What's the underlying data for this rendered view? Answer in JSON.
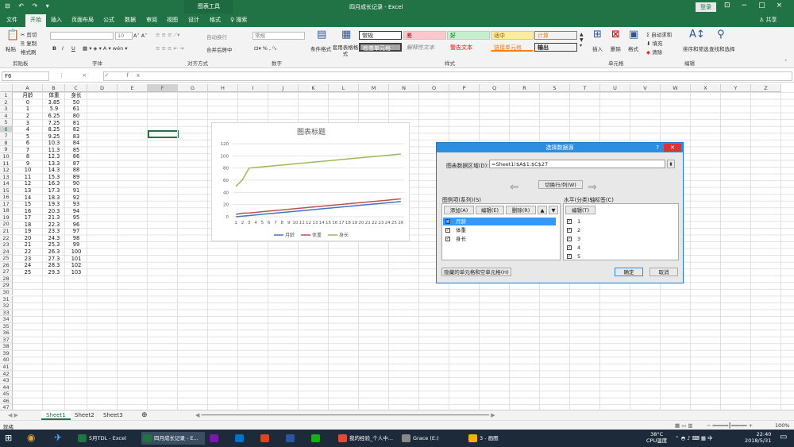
{
  "titlebar": {
    "context_tab": "图表工具",
    "window_title": "四月成长记录 - Excel",
    "login": "登录",
    "quick_access": "⊟ ↶ ↷ ▾"
  },
  "tabs": [
    "文件",
    "开始",
    "插入",
    "页面布局",
    "公式",
    "数据",
    "审阅",
    "视图",
    "设计",
    "格式",
    "♀ 搜索"
  ],
  "share": "共享",
  "ribbon": {
    "clipboard": {
      "paste": "粘贴",
      "cut": "✂ 剪切",
      "copy": "⎘ 复制",
      "format_painter": "格式刷",
      "group": "剪贴板"
    },
    "font": {
      "size": "10",
      "bold": "B",
      "italic": "I",
      "underline": "U",
      "group": "字体"
    },
    "alignment": {
      "wrap": "自动换行",
      "merge": "合并后居中",
      "group": "对齐方式"
    },
    "number": {
      "format": "常规",
      "percent": "%",
      "group": "数字"
    },
    "styles": {
      "conditional": "条件格式",
      "table": "套用表格格式",
      "normal": "常规",
      "bad": "差",
      "good": "好",
      "neutral": "适中",
      "calc": "计算",
      "check": "检查单元格",
      "explain": "解释性文本",
      "warn": "警告文本",
      "link": "链接单元格",
      "output": "输出",
      "group": "样式"
    },
    "cells": {
      "insert": "插入",
      "delete": "删除",
      "format": "格式",
      "group": "单元格"
    },
    "editing": {
      "autosum": "Σ 自动求和",
      "fill": "填充",
      "clear": "清除",
      "sort": "排序和筛选",
      "find": "查找和选择",
      "group": "编辑"
    }
  },
  "formula_bar": {
    "name_box": "F6",
    "icons": "⋮ × ✓ fx",
    "value": ""
  },
  "columns": [
    "A",
    "B",
    "C",
    "D",
    "E",
    "F",
    "G",
    "H",
    "I",
    "J",
    "K",
    "L",
    "M",
    "N",
    "O",
    "P",
    "Q",
    "R",
    "S",
    "T",
    "U",
    "V",
    "W",
    "X",
    "Y",
    "Z"
  ],
  "rows": [
    "1",
    "2",
    "3",
    "4",
    "5",
    "6",
    "7",
    "8",
    "9",
    "10",
    "11",
    "12",
    "13",
    "14",
    "15",
    "16",
    "17",
    "18",
    "19",
    "20",
    "21",
    "22",
    "23",
    "24",
    "25",
    "26",
    "27",
    "28",
    "29",
    "30",
    "31",
    "32",
    "33",
    "34",
    "35",
    "36",
    "37",
    "38",
    "39",
    "40",
    "41",
    "42",
    "43",
    "44",
    "45",
    "46",
    "47"
  ],
  "table": {
    "headers": [
      "月龄",
      "体重",
      "身长"
    ],
    "rows": [
      [
        "0",
        "3.85",
        "50"
      ],
      [
        "1",
        "5.9",
        "61"
      ],
      [
        "2",
        "6.25",
        "80"
      ],
      [
        "3",
        "7.25",
        "81"
      ],
      [
        "4",
        "8.25",
        "82"
      ],
      [
        "5",
        "9.25",
        "83"
      ],
      [
        "6",
        "10.3",
        "84"
      ],
      [
        "7",
        "11.3",
        "85"
      ],
      [
        "8",
        "12.3",
        "86"
      ],
      [
        "9",
        "13.3",
        "87"
      ],
      [
        "10",
        "14.3",
        "88"
      ],
      [
        "11",
        "15.3",
        "89"
      ],
      [
        "12",
        "16.3",
        "90"
      ],
      [
        "13",
        "17.3",
        "91"
      ],
      [
        "14",
        "18.3",
        "92"
      ],
      [
        "15",
        "19.3",
        "93"
      ],
      [
        "16",
        "20.3",
        "94"
      ],
      [
        "17",
        "21.3",
        "95"
      ],
      [
        "18",
        "22.3",
        "96"
      ],
      [
        "19",
        "23.3",
        "97"
      ],
      [
        "20",
        "24.3",
        "98"
      ],
      [
        "21",
        "25.3",
        "99"
      ],
      [
        "22",
        "26.3",
        "100"
      ],
      [
        "23",
        "27.3",
        "101"
      ],
      [
        "24",
        "28.3",
        "102"
      ],
      [
        "25",
        "29.3",
        "103"
      ]
    ]
  },
  "chart_data": {
    "type": "line",
    "title": "图表标题",
    "categories": [
      "1",
      "2",
      "3",
      "4",
      "5",
      "6",
      "7",
      "8",
      "9",
      "10",
      "11",
      "12",
      "13",
      "14",
      "15",
      "16",
      "17",
      "18",
      "19",
      "20",
      "21",
      "22",
      "23",
      "24",
      "25",
      "26"
    ],
    "series": [
      {
        "name": "月龄",
        "color": "#4472c4",
        "values": [
          0,
          1,
          2,
          3,
          4,
          5,
          6,
          7,
          8,
          9,
          10,
          11,
          12,
          13,
          14,
          15,
          16,
          17,
          18,
          19,
          20,
          21,
          22,
          23,
          24,
          25
        ]
      },
      {
        "name": "体重",
        "color": "#c0504d",
        "values": [
          3.85,
          5.9,
          6.25,
          7.25,
          8.25,
          9.25,
          10.3,
          11.3,
          12.3,
          13.3,
          14.3,
          15.3,
          16.3,
          17.3,
          18.3,
          19.3,
          20.3,
          21.3,
          22.3,
          23.3,
          24.3,
          25.3,
          26.3,
          27.3,
          28.3,
          29.3
        ]
      },
      {
        "name": "身长",
        "color": "#9bbb59",
        "values": [
          50,
          61,
          80,
          81,
          82,
          83,
          84,
          85,
          86,
          87,
          88,
          89,
          90,
          91,
          92,
          93,
          94,
          95,
          96,
          97,
          98,
          99,
          100,
          101,
          102,
          103
        ]
      }
    ],
    "ylim": [
      0,
      120
    ],
    "yticks": [
      "0",
      "20",
      "40",
      "60",
      "80",
      "100",
      "120"
    ],
    "grid": true,
    "legend": "bottom"
  },
  "dialog": {
    "title": "选择数据源",
    "help": "?",
    "range_label": "图表数据区域(D):",
    "range_value": "=Sheet1!$A$1:$C$27",
    "switch_btn": "切换行/列(W)",
    "legend_label": "图例项(系列)(S)",
    "axis_label": "水平(分类)轴标签(C)",
    "add": "添加(A)",
    "edit": "编辑(E)",
    "remove": "删除(R)",
    "axis_edit": "编辑(T)",
    "series": [
      "月龄",
      "体重",
      "身长"
    ],
    "axis_items": [
      "1",
      "2",
      "3",
      "4",
      "5"
    ],
    "hidden_btn": "隐藏的单元格和空单元格(H)",
    "ok": "确定",
    "cancel": "取消"
  },
  "sheets": [
    "Sheet1",
    "Sheet2",
    "Sheet3"
  ],
  "status": {
    "ready": "就绪",
    "zoom": "100%"
  },
  "taskbar": {
    "items": [
      {
        "label": "5月TDL - Excel",
        "color": "#217346"
      },
      {
        "label": "四月成长记录 - E...",
        "color": "#217346"
      },
      {
        "label": "",
        "color": "#7719aa"
      },
      {
        "label": "",
        "color": "#0072c6"
      },
      {
        "label": "",
        "color": "#d24726"
      },
      {
        "label": "",
        "color": "#2b579a"
      },
      {
        "label": "",
        "color": "#1aad19"
      },
      {
        "label": "我的经验_个人中...",
        "color": "#dd4b39"
      },
      {
        "label": "Grace (E:)",
        "color": "#888888"
      },
      {
        "label": "3 - 画图",
        "color": "#f2b100"
      }
    ],
    "temp": "38°C",
    "cpu": "CPU温度",
    "time": "22:40",
    "date": "2018/5/31"
  }
}
